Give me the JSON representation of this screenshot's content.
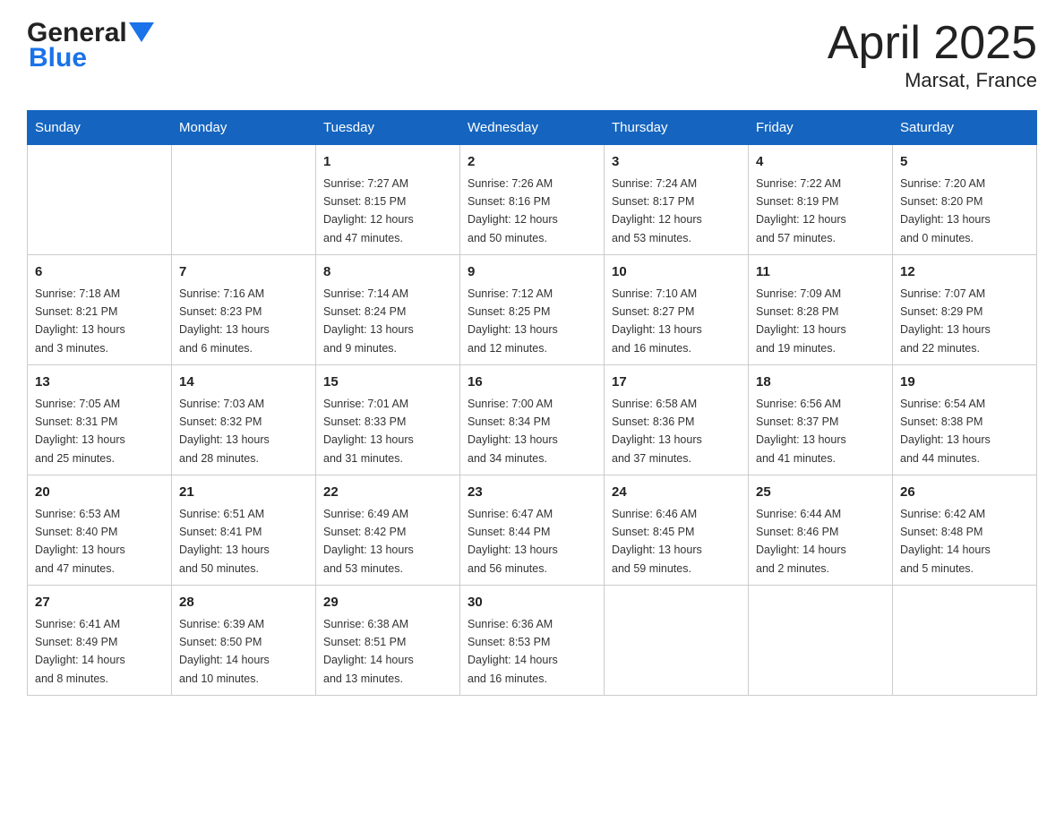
{
  "header": {
    "title": "April 2025",
    "subtitle": "Marsat, France",
    "logo_general": "General",
    "logo_blue": "Blue"
  },
  "weekdays": [
    "Sunday",
    "Monday",
    "Tuesday",
    "Wednesday",
    "Thursday",
    "Friday",
    "Saturday"
  ],
  "weeks": [
    [
      {
        "num": "",
        "info": ""
      },
      {
        "num": "",
        "info": ""
      },
      {
        "num": "1",
        "info": "Sunrise: 7:27 AM\nSunset: 8:15 PM\nDaylight: 12 hours\nand 47 minutes."
      },
      {
        "num": "2",
        "info": "Sunrise: 7:26 AM\nSunset: 8:16 PM\nDaylight: 12 hours\nand 50 minutes."
      },
      {
        "num": "3",
        "info": "Sunrise: 7:24 AM\nSunset: 8:17 PM\nDaylight: 12 hours\nand 53 minutes."
      },
      {
        "num": "4",
        "info": "Sunrise: 7:22 AM\nSunset: 8:19 PM\nDaylight: 12 hours\nand 57 minutes."
      },
      {
        "num": "5",
        "info": "Sunrise: 7:20 AM\nSunset: 8:20 PM\nDaylight: 13 hours\nand 0 minutes."
      }
    ],
    [
      {
        "num": "6",
        "info": "Sunrise: 7:18 AM\nSunset: 8:21 PM\nDaylight: 13 hours\nand 3 minutes."
      },
      {
        "num": "7",
        "info": "Sunrise: 7:16 AM\nSunset: 8:23 PM\nDaylight: 13 hours\nand 6 minutes."
      },
      {
        "num": "8",
        "info": "Sunrise: 7:14 AM\nSunset: 8:24 PM\nDaylight: 13 hours\nand 9 minutes."
      },
      {
        "num": "9",
        "info": "Sunrise: 7:12 AM\nSunset: 8:25 PM\nDaylight: 13 hours\nand 12 minutes."
      },
      {
        "num": "10",
        "info": "Sunrise: 7:10 AM\nSunset: 8:27 PM\nDaylight: 13 hours\nand 16 minutes."
      },
      {
        "num": "11",
        "info": "Sunrise: 7:09 AM\nSunset: 8:28 PM\nDaylight: 13 hours\nand 19 minutes."
      },
      {
        "num": "12",
        "info": "Sunrise: 7:07 AM\nSunset: 8:29 PM\nDaylight: 13 hours\nand 22 minutes."
      }
    ],
    [
      {
        "num": "13",
        "info": "Sunrise: 7:05 AM\nSunset: 8:31 PM\nDaylight: 13 hours\nand 25 minutes."
      },
      {
        "num": "14",
        "info": "Sunrise: 7:03 AM\nSunset: 8:32 PM\nDaylight: 13 hours\nand 28 minutes."
      },
      {
        "num": "15",
        "info": "Sunrise: 7:01 AM\nSunset: 8:33 PM\nDaylight: 13 hours\nand 31 minutes."
      },
      {
        "num": "16",
        "info": "Sunrise: 7:00 AM\nSunset: 8:34 PM\nDaylight: 13 hours\nand 34 minutes."
      },
      {
        "num": "17",
        "info": "Sunrise: 6:58 AM\nSunset: 8:36 PM\nDaylight: 13 hours\nand 37 minutes."
      },
      {
        "num": "18",
        "info": "Sunrise: 6:56 AM\nSunset: 8:37 PM\nDaylight: 13 hours\nand 41 minutes."
      },
      {
        "num": "19",
        "info": "Sunrise: 6:54 AM\nSunset: 8:38 PM\nDaylight: 13 hours\nand 44 minutes."
      }
    ],
    [
      {
        "num": "20",
        "info": "Sunrise: 6:53 AM\nSunset: 8:40 PM\nDaylight: 13 hours\nand 47 minutes."
      },
      {
        "num": "21",
        "info": "Sunrise: 6:51 AM\nSunset: 8:41 PM\nDaylight: 13 hours\nand 50 minutes."
      },
      {
        "num": "22",
        "info": "Sunrise: 6:49 AM\nSunset: 8:42 PM\nDaylight: 13 hours\nand 53 minutes."
      },
      {
        "num": "23",
        "info": "Sunrise: 6:47 AM\nSunset: 8:44 PM\nDaylight: 13 hours\nand 56 minutes."
      },
      {
        "num": "24",
        "info": "Sunrise: 6:46 AM\nSunset: 8:45 PM\nDaylight: 13 hours\nand 59 minutes."
      },
      {
        "num": "25",
        "info": "Sunrise: 6:44 AM\nSunset: 8:46 PM\nDaylight: 14 hours\nand 2 minutes."
      },
      {
        "num": "26",
        "info": "Sunrise: 6:42 AM\nSunset: 8:48 PM\nDaylight: 14 hours\nand 5 minutes."
      }
    ],
    [
      {
        "num": "27",
        "info": "Sunrise: 6:41 AM\nSunset: 8:49 PM\nDaylight: 14 hours\nand 8 minutes."
      },
      {
        "num": "28",
        "info": "Sunrise: 6:39 AM\nSunset: 8:50 PM\nDaylight: 14 hours\nand 10 minutes."
      },
      {
        "num": "29",
        "info": "Sunrise: 6:38 AM\nSunset: 8:51 PM\nDaylight: 14 hours\nand 13 minutes."
      },
      {
        "num": "30",
        "info": "Sunrise: 6:36 AM\nSunset: 8:53 PM\nDaylight: 14 hours\nand 16 minutes."
      },
      {
        "num": "",
        "info": ""
      },
      {
        "num": "",
        "info": ""
      },
      {
        "num": "",
        "info": ""
      }
    ]
  ]
}
